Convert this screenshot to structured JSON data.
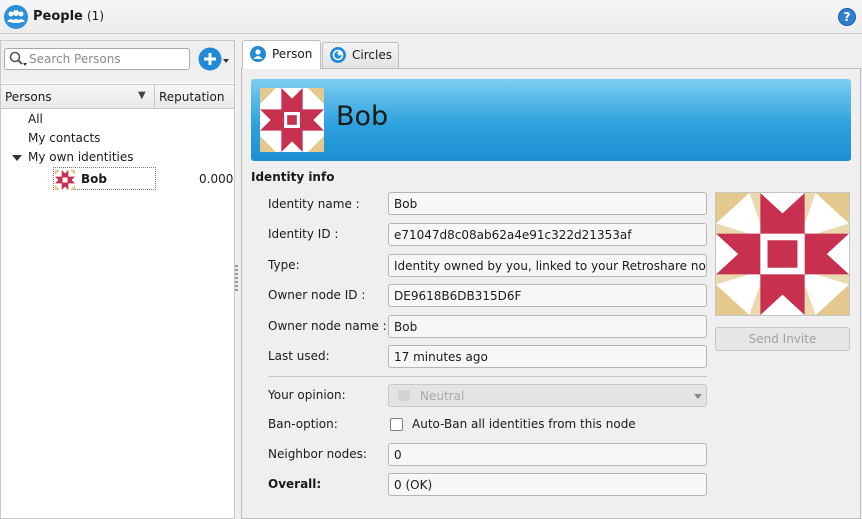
{
  "window": {
    "title": "People",
    "count": "(1)",
    "help_glyph": "?"
  },
  "search": {
    "placeholder": "Search Persons",
    "value": ""
  },
  "tree": {
    "headers": {
      "persons": "Persons",
      "reputation": "Reputation",
      "sort_glyph": "▼"
    },
    "items": [
      {
        "label": "All"
      },
      {
        "label": "My contacts"
      },
      {
        "label": "My own identities"
      }
    ],
    "child": {
      "name": "Bob",
      "reputation": "0.000"
    }
  },
  "tabs": [
    {
      "label": "Person",
      "icon": "person-icon"
    },
    {
      "label": "Circles",
      "icon": "circles-icon"
    }
  ],
  "identity": {
    "name_display": "Bob",
    "section_title": "Identity info",
    "fields": [
      {
        "label": "Identity name :",
        "value": "Bob"
      },
      {
        "label": "Identity ID :",
        "value": "e71047d8c08ab62a4e91c322d21353af"
      },
      {
        "label": "Type:",
        "value": "Identity owned by you, linked to your Retroshare node"
      },
      {
        "label": "Owner node ID :",
        "value": "DE9618B6DB315D6F"
      },
      {
        "label": "Owner node name :",
        "value": "Bob"
      },
      {
        "label": "Last used:",
        "value": "17 minutes ago"
      }
    ],
    "opinion": {
      "label": "Your opinion:",
      "value": "Neutral"
    },
    "ban": {
      "label": "Ban-option:",
      "checkbox_label": "Auto-Ban all identities from this node"
    },
    "neighbor": {
      "label": "Neighbor nodes:",
      "value": "0"
    },
    "overall": {
      "label": "Overall:",
      "value": "0 (OK)"
    },
    "send_invite": "Send Invite"
  },
  "colors": {
    "banner_top": "#7ccdf0",
    "banner_bottom": "#1b8fd2",
    "avatar_red": "#c8304f",
    "avatar_tan": "#e4c98e"
  }
}
